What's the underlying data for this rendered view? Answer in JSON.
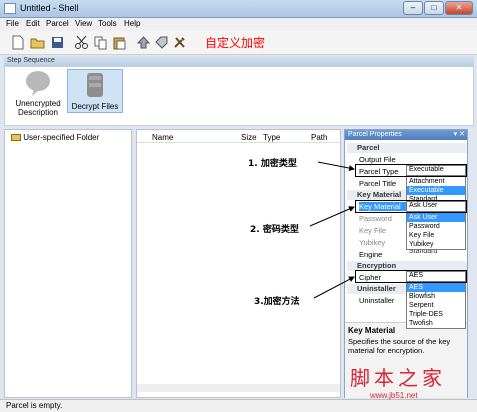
{
  "window": {
    "title": "Untitled - Shell"
  },
  "menu": [
    "File",
    "Edit",
    "Parcel",
    "View",
    "Tools",
    "Help"
  ],
  "toolbar_annotation": "自定义加密",
  "step_sequence": {
    "header": "Step Sequence",
    "steps": [
      {
        "label": "Unencrypted Description"
      },
      {
        "label": "Decrypt Files"
      }
    ]
  },
  "tree": {
    "root": "User-specified Folder"
  },
  "file_list": {
    "columns": [
      "Name",
      "Size",
      "Type",
      "Path"
    ]
  },
  "properties": {
    "header": "Parcel Properties",
    "categories": {
      "parcel": "Parcel",
      "key_material": "Key Material",
      "encryption": "Encryption",
      "uninstaller": "Uninstaller"
    },
    "rows": {
      "output_file": "Output File",
      "parcel_type": "Parcel Type",
      "parcel_title": "Parcel Title",
      "key_material": "Key Material",
      "password": "Password",
      "key_file": "Key File",
      "yubikey": "Yubikey",
      "engine": "Engine",
      "cipher": "Cipher",
      "uninstaller": "Uninstaller"
    },
    "values": {
      "parcel_type": "Executable",
      "key_material": "Ask User",
      "engine": "Standard",
      "cipher": "AES"
    },
    "dropdowns": {
      "parcel_type": [
        "Attachment",
        "Executable",
        "Standard"
      ],
      "key_material": [
        "Ask User",
        "Password",
        "Key File",
        "Yubikey"
      ],
      "cipher": [
        "AES",
        "Blowfish",
        "Serpent",
        "Triple-DES",
        "Twofish"
      ]
    },
    "description": {
      "title": "Key Material",
      "text": "Specifies the source of the key material for encryption."
    }
  },
  "annotations": {
    "parcel_type": "1. 加密类型",
    "key_material": "2. 密码类型",
    "cipher": "3.加密方法"
  },
  "status": "Parcel is empty.",
  "watermark": {
    "text": "脚本之家",
    "url": "www.jb51.net"
  },
  "colors": {
    "annotation_red": "#ff0000",
    "selection": "#3399ff",
    "panel_header": "#4f7fbf"
  }
}
